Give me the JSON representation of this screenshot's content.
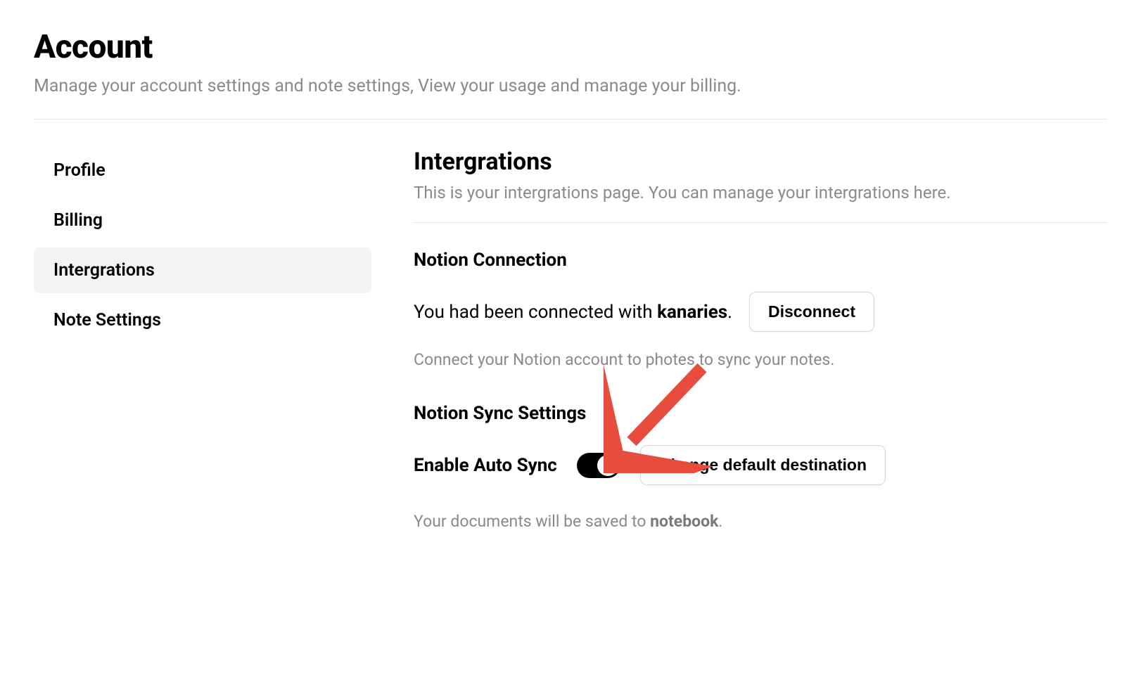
{
  "header": {
    "title": "Account",
    "subtitle": "Manage your account settings and note settings, View your usage and manage your billing."
  },
  "sidebar": {
    "items": [
      {
        "label": "Profile",
        "active": false
      },
      {
        "label": "Billing",
        "active": false
      },
      {
        "label": "Intergrations",
        "active": true
      },
      {
        "label": "Note Settings",
        "active": false
      }
    ]
  },
  "main": {
    "title": "Intergrations",
    "subtitle": "This is your intergrations page. You can manage your intergrations here.",
    "notion_connection": {
      "heading": "Notion Connection",
      "status_prefix": "You had been connected with ",
      "workspace": "kanaries",
      "status_suffix": ".",
      "disconnect_label": "Disconnect",
      "helper": "Connect your Notion account to photes to sync your notes."
    },
    "sync_settings": {
      "heading": "Notion Sync Settings",
      "toggle_label": "Enable Auto Sync",
      "toggle_on": true,
      "change_dest_label": "Change default destination",
      "dest_prefix": "Your documents will be saved to ",
      "dest_value": "notebook",
      "dest_suffix": "."
    }
  }
}
